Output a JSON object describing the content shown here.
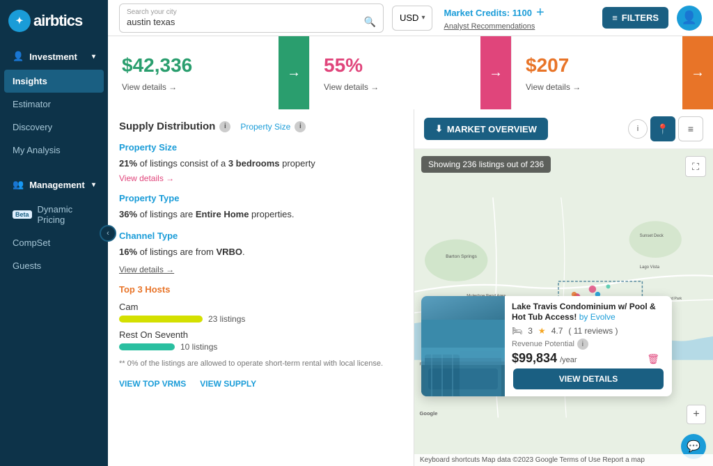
{
  "app": {
    "logo": "airbtics",
    "logo_icon": "~"
  },
  "sidebar": {
    "investment_label": "Investment",
    "insights_label": "Insights",
    "estimator_label": "Estimator",
    "discovery_label": "Discovery",
    "my_analysis_label": "My Analysis",
    "management_label": "Management",
    "dynamic_pricing_label": "Dynamic Pricing",
    "dynamic_pricing_badge": "Beta",
    "compset_label": "CompSet",
    "guests_label": "Guests"
  },
  "topbar": {
    "search_label": "Search your city",
    "search_placeholder": "austin texas",
    "currency_value": "USD",
    "credits_label": "Market Credits: 1100",
    "analyst_label": "Analyst Recommendations",
    "filters_label": "FILTERS"
  },
  "metrics": [
    {
      "value": "$42,336",
      "color": "green",
      "link_label": "View details →"
    },
    {
      "value": "55%",
      "color": "pink",
      "link_label": "View details →"
    },
    {
      "value": "$207",
      "color": "orange",
      "link_label": "View details →"
    }
  ],
  "supply": {
    "title": "Supply Distribution",
    "property_size_title": "Property Size",
    "property_size_info": "21% of listings consist of a 3 bedrooms property",
    "view_details_label": "View details →",
    "property_type_title": "Property Type",
    "property_type_info_prefix": "36% of listings are",
    "property_type_bold": "Entire Home",
    "property_type_suffix": "properties.",
    "channel_type_title": "Channel Type",
    "channel_type_info_prefix": "16% of listings are from",
    "channel_type_bold": "VRBO",
    "channel_type_suffix": ".",
    "view_details2_label": "View details →",
    "top_hosts_title": "Top 3 Hosts",
    "host1_name": "Cam",
    "host1_count": "23 listings",
    "host2_name": "Rest On Seventh",
    "host2_count": "10 listings",
    "footnote": "** 0% of the listings are allowed to operate short-term rental with local license.",
    "view_top_vrms_label": "VIEW TOP VRMS",
    "view_supply_label": "VIEW SUPPLY",
    "percent_21": "21%",
    "bold_3_bedrooms": "3 bedrooms",
    "percent_36": "36%",
    "percent_16": "16%"
  },
  "map": {
    "overview_btn_label": "MARKET OVERVIEW",
    "badge_text": "Showing 236 listings out of 236",
    "property_title": "Lake Travis Condominium w/ Pool & Hot Tub Access!",
    "property_by": "by Evolve",
    "property_beds": "3",
    "property_rating": "4.7",
    "property_reviews": "11 reviews",
    "revenue_label": "Revenue Potential",
    "revenue_value": "$99,834",
    "revenue_per": "/year",
    "view_details_btn": "VIEW DETAILS",
    "map_credits": "Keyboard shortcuts  Map data ©2023 Google  Terms of Use  Report a map"
  },
  "icons": {
    "search": "🔍",
    "filter": "≡",
    "download": "⬇",
    "location_pin": "📍",
    "list": "≡",
    "expand": "⛶",
    "plus": "+",
    "minus": "−",
    "chat": "💬",
    "arrow_right": "→",
    "info": "i",
    "star": "★",
    "bed": "🛏",
    "trash": "🗑",
    "chevron_down": "▾",
    "chevron_left": "‹"
  }
}
